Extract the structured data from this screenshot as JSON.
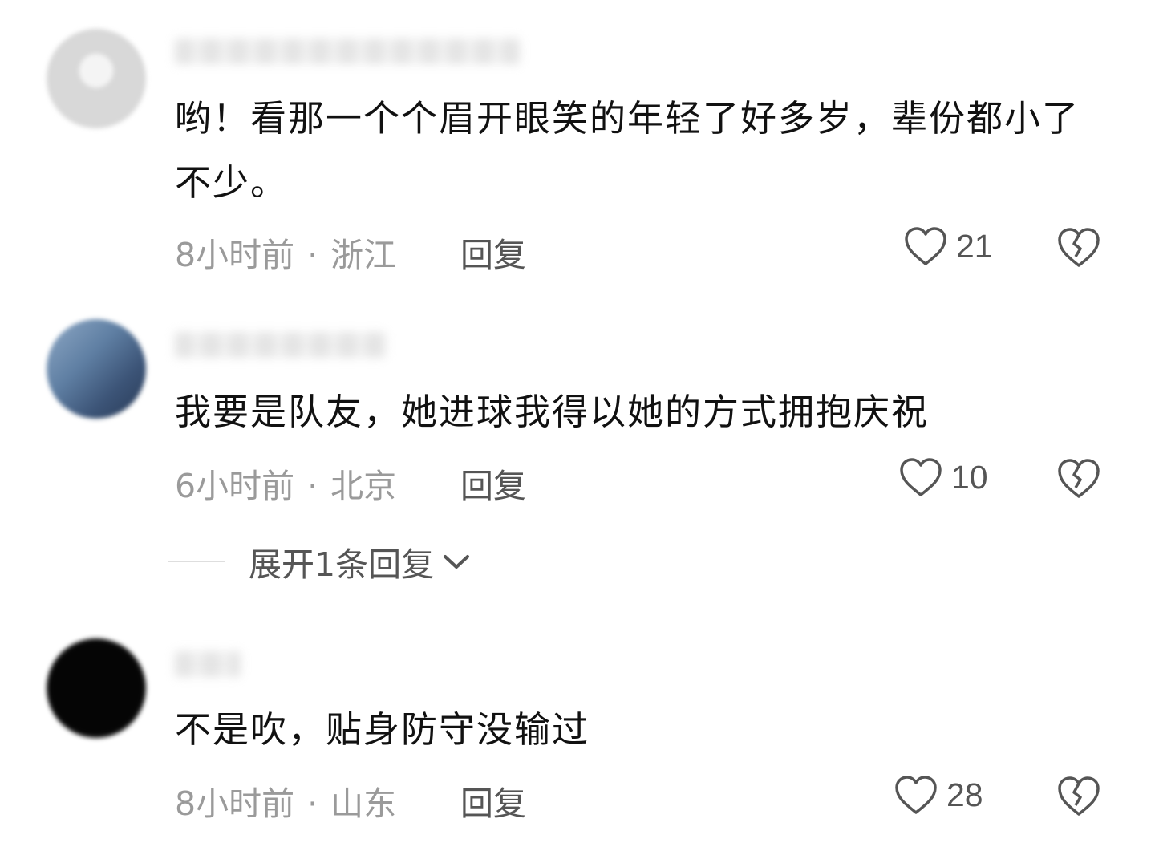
{
  "comments": [
    {
      "text": "哟！看那一个个眉开眼笑的年轻了好多岁，辈份都小了不少。",
      "time": "8小时前",
      "separator": "·",
      "location": "浙江",
      "reply_label": "回复",
      "likes": "21"
    },
    {
      "text": "我要是队友，她进球我得以她的方式拥抱庆祝",
      "time": "6小时前",
      "separator": "·",
      "location": "北京",
      "reply_label": "回复",
      "likes": "10"
    },
    {
      "text": "不是吹，贴身防守没输过",
      "time": "8小时前",
      "separator": "·",
      "location": "山东",
      "reply_label": "回复",
      "likes": "28"
    }
  ],
  "expand_replies": {
    "label": "展开1条回复"
  },
  "icons": {
    "like": "heart-outline-icon",
    "dislike": "broken-heart-icon",
    "expand": "chevron-down-icon"
  },
  "colors": {
    "text": "#111111",
    "meta": "#9a9a9a",
    "action": "#555555"
  }
}
